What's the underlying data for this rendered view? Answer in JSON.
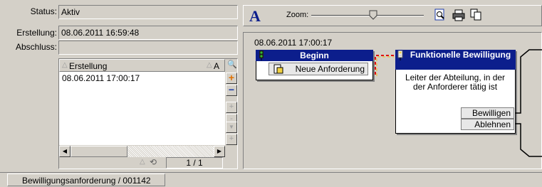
{
  "form": {
    "status_label": "Status:",
    "status_value": "Aktiv",
    "created_label": "Erstellung:",
    "created_value": "08.06.2011 16:59:48",
    "closed_label": "Abschluss:",
    "closed_value": ""
  },
  "grid": {
    "column_header": "Erstellung",
    "column_header_right": "A",
    "rows": [
      "08.06.2011 17:00:17"
    ],
    "pager": "1 / 1"
  },
  "toolbar": {
    "font_glyph": "A",
    "zoom_label": "Zoom:",
    "zoom_level": 0.55
  },
  "workflow": {
    "timestamp": "08.06.2011 17:00:17",
    "start": {
      "title": "Beginn",
      "event": "Neue Anforderung"
    },
    "approval": {
      "title": "Funktionelle Bewilligung",
      "description": "Leiter der Abteilung, in der der Anforderer tätig ist",
      "approve": "Bewilligen",
      "reject": "Ablehnen"
    }
  },
  "statusbar": {
    "tab_label": "Bewilligungsanforderung / 001142"
  },
  "colors": {
    "workflow_header": "#0c1e8c",
    "accent_plus": "#e07000",
    "accent_minus": "#1a3aa8",
    "link_line": "#e01010"
  }
}
